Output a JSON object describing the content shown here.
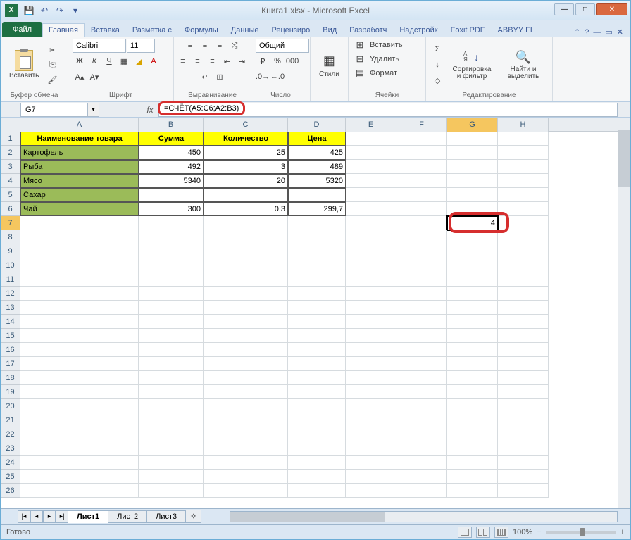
{
  "title": "Книга1.xlsx - Microsoft Excel",
  "tabs": {
    "file": "Файл",
    "list": [
      "Главная",
      "Вставка",
      "Разметка с",
      "Формулы",
      "Данные",
      "Рецензиро",
      "Вид",
      "Разработч",
      "Надстройк",
      "Foxit PDF",
      "ABBYY FI"
    ],
    "active_index": 0
  },
  "ribbon": {
    "clipboard": {
      "label": "Буфер обмена",
      "paste": "Вставить"
    },
    "font": {
      "label": "Шрифт",
      "name": "Calibri",
      "size": "11"
    },
    "alignment": {
      "label": "Выравнивание"
    },
    "number": {
      "label": "Число",
      "format": "Общий"
    },
    "styles": {
      "label": "Стили"
    },
    "cells": {
      "label": "Ячейки",
      "insert": "Вставить",
      "delete": "Удалить",
      "format": "Формат"
    },
    "editing": {
      "label": "Редактирование",
      "sort": "Сортировка и фильтр",
      "find": "Найти и выделить"
    }
  },
  "namebox": "G7",
  "formula": "=СЧЁТ(A5:C6;A2:B3)",
  "columns": [
    {
      "id": "A",
      "w": 168
    },
    {
      "id": "B",
      "w": 92
    },
    {
      "id": "C",
      "w": 120
    },
    {
      "id": "D",
      "w": 82
    },
    {
      "id": "E",
      "w": 72
    },
    {
      "id": "F",
      "w": 72
    },
    {
      "id": "G",
      "w": 72
    },
    {
      "id": "H",
      "w": 72
    }
  ],
  "headers": {
    "a": "Наименование товара",
    "b": "Сумма",
    "c": "Количество",
    "d": "Цена"
  },
  "data_rows": [
    {
      "name": "Картофель",
      "b": "450",
      "c": "25",
      "d": "425"
    },
    {
      "name": "Рыба",
      "b": "492",
      "c": "3",
      "d": "489"
    },
    {
      "name": "Мясо",
      "b": "5340",
      "c": "20",
      "d": "5320"
    },
    {
      "name": "Сахар",
      "b": "",
      "c": "",
      "d": ""
    },
    {
      "name": "Чай",
      "b": "300",
      "c": "0,3",
      "d": "299,7"
    }
  ],
  "active_cell_value": "4",
  "sheets": [
    "Лист1",
    "Лист2",
    "Лист3"
  ],
  "status": {
    "ready": "Готово",
    "zoom": "100%"
  }
}
